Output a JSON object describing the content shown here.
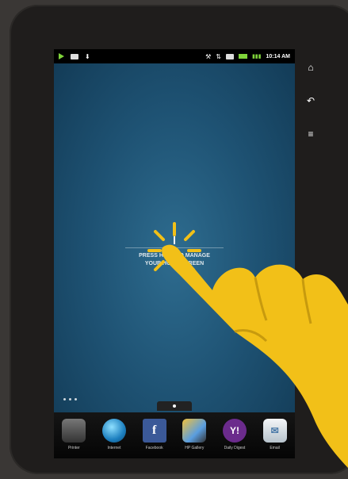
{
  "status_bar": {
    "time": "10:14 AM",
    "icons": [
      "play-icon",
      "message-icon",
      "download-icon",
      "usb-icon",
      "wifi-icon",
      "sd-card-icon",
      "battery-icon",
      "signal-icon"
    ],
    "accent_color": "#7fd43a"
  },
  "home": {
    "press_line_1": "PRESS HERE TO MANAGE",
    "press_line_2": "YOUR HOME SCREEN"
  },
  "dock": {
    "items": [
      {
        "label": "Printer",
        "icon": "printer-icon"
      },
      {
        "label": "Internet",
        "icon": "globe-icon"
      },
      {
        "label": "Facebook",
        "icon": "facebook-icon",
        "glyph": "f"
      },
      {
        "label": "HP Gallery",
        "icon": "gallery-icon"
      },
      {
        "label": "Daily Digest",
        "icon": "yahoo-icon",
        "glyph": "Y!"
      },
      {
        "label": "Email",
        "icon": "email-icon",
        "glyph": "✉"
      }
    ]
  },
  "side_buttons": {
    "home": "⌂",
    "back": "↶",
    "menu": "≡"
  },
  "colors": {
    "hand": "#f2c018",
    "screen": "#1e5273"
  }
}
